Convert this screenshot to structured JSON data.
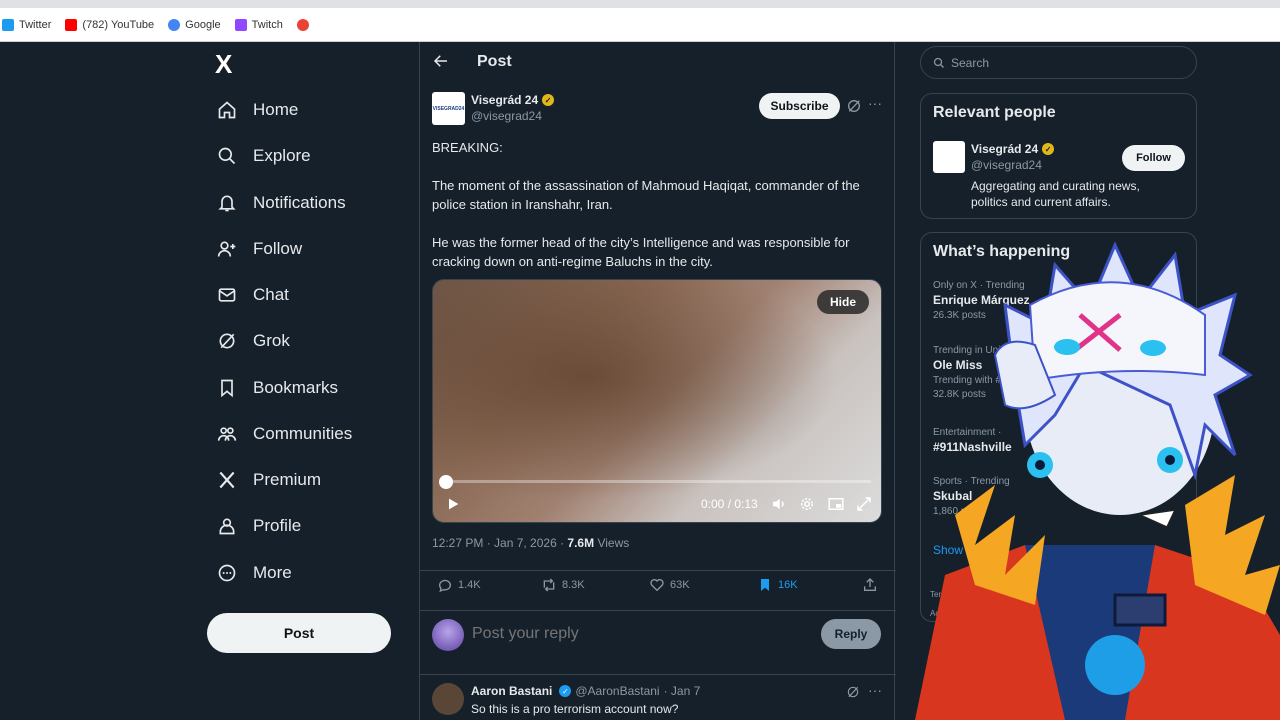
{
  "browser": {
    "bookmarks": [
      {
        "label": "Twitter",
        "icon": "twitter-icon",
        "color": "#1d9bf0"
      },
      {
        "label": "(782) YouTube",
        "icon": "youtube-icon",
        "color": "#ff0000"
      },
      {
        "label": "Google",
        "icon": "google-icon",
        "color": "#4285f4"
      },
      {
        "label": "Twitch",
        "icon": "twitch-icon",
        "color": "#9146ff"
      },
      {
        "label": "",
        "icon": "google-icon",
        "color": "#4285f4"
      }
    ]
  },
  "nav": {
    "logo": "X",
    "items": [
      {
        "label": "Home",
        "icon": "home-icon"
      },
      {
        "label": "Explore",
        "icon": "search-icon"
      },
      {
        "label": "Notifications",
        "icon": "bell-icon"
      },
      {
        "label": "Follow",
        "icon": "add-person-icon"
      },
      {
        "label": "Chat",
        "icon": "mail-icon"
      },
      {
        "label": "Grok",
        "icon": "grok-icon"
      },
      {
        "label": "Bookmarks",
        "icon": "bookmark-icon"
      },
      {
        "label": "Communities",
        "icon": "communities-icon"
      },
      {
        "label": "Premium",
        "icon": "x-icon"
      },
      {
        "label": "Profile",
        "icon": "person-icon"
      },
      {
        "label": "More",
        "icon": "more-circle-icon"
      }
    ],
    "post_label": "Post"
  },
  "center": {
    "title": "Post",
    "tweet": {
      "name": "Visegrád 24",
      "handle": "@visegrad24",
      "avatar_text": "VISEGRAD24",
      "subscribe_label": "Subscribe",
      "text": [
        "BREAKING:",
        "The moment of the assassination of Mahmoud Haqiqat, commander of the police station in Iranshahr, Iran.",
        "He was the former head of the city’s Intelligence and was responsible for cracking down on anti-regime Baluchs in the city."
      ],
      "video": {
        "hide_label": "Hide",
        "time": "0:00 / 0:13",
        "progress": 0.0
      },
      "timestamp": "12:27 PM · Jan 7, 2026 · ",
      "views": "7.6M",
      "views_label": " Views",
      "stats": {
        "replies": "1.4K",
        "reposts": "8.3K",
        "likes": "63K",
        "bookmarks": "16K"
      }
    },
    "reply_box": {
      "placeholder": "Post your reply",
      "button": "Reply"
    },
    "reply_tweet": {
      "name": "Aaron Bastani",
      "handle": "@AaronBastani",
      "date": "· Jan 7",
      "text": "So this is a pro terrorism account now?"
    }
  },
  "right": {
    "search_placeholder": "Search",
    "relevant": {
      "title": "Relevant people",
      "name": "Visegrád 24",
      "handle": "@visegrad24",
      "bio": "Aggregating and curating news, politics and current affairs.",
      "follow_label": "Follow"
    },
    "happening": {
      "title": "What’s happening",
      "trends": [
        {
          "meta": "Only on X · Trending",
          "name": "Enrique Márquez",
          "count": "26.3K posts"
        },
        {
          "meta": "Trending in United",
          "name": "Ole Miss",
          "count": "Trending with #",
          "count2": "32.8K posts"
        },
        {
          "meta": "Entertainment ·",
          "name": "#911Nashville",
          "count": ""
        },
        {
          "meta": "Sports · Trending",
          "name": "Skubal",
          "count": "1,860 posts"
        }
      ],
      "show_more": "Show m",
      "terms": [
        "Terms of",
        "Accessib"
      ]
    }
  },
  "colors": {
    "background": "#15202b",
    "accent": "#1d9bf0",
    "verified_gold": "#e2b719"
  }
}
